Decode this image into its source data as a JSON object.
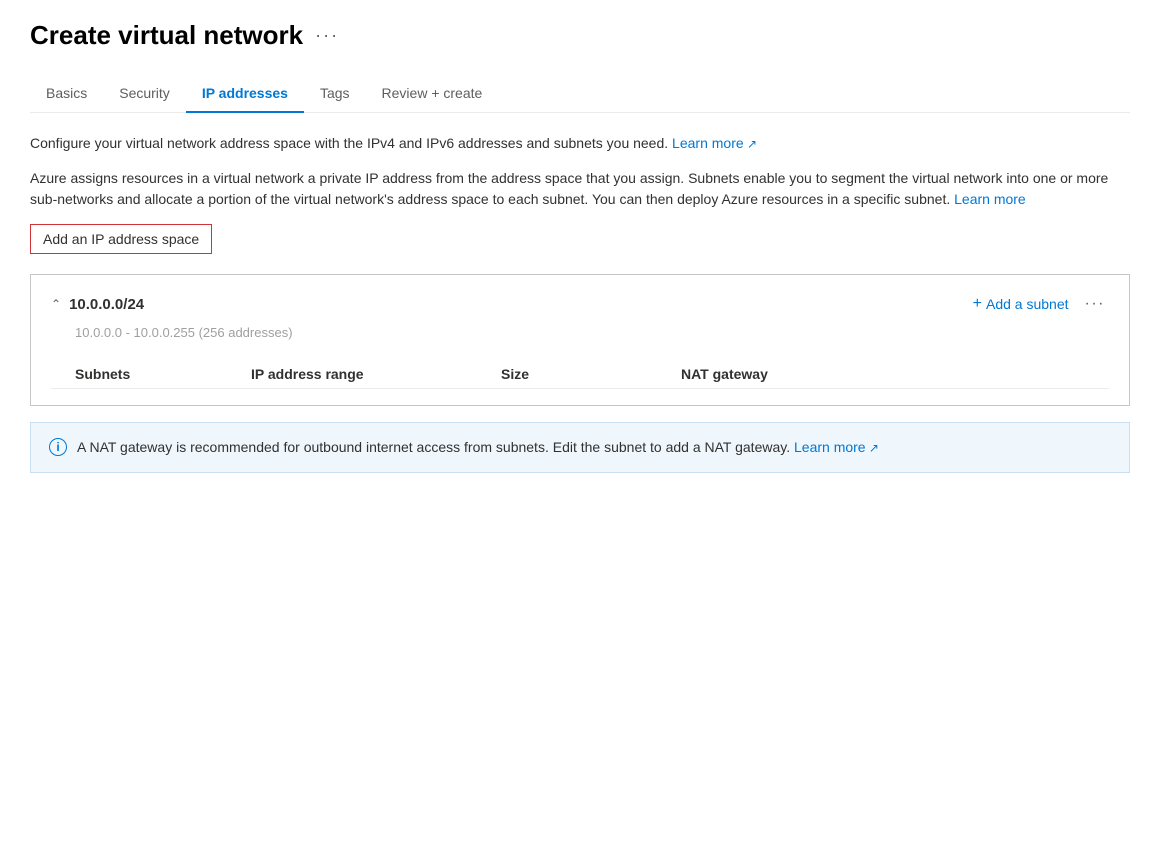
{
  "page": {
    "title": "Create virtual network",
    "more_icon": "···"
  },
  "tabs": [
    {
      "id": "basics",
      "label": "Basics",
      "active": false
    },
    {
      "id": "security",
      "label": "Security",
      "active": false
    },
    {
      "id": "ip-addresses",
      "label": "IP addresses",
      "active": true
    },
    {
      "id": "tags",
      "label": "Tags",
      "active": false
    },
    {
      "id": "review-create",
      "label": "Review + create",
      "active": false
    }
  ],
  "description1": "Configure your virtual network address space with the IPv4 and IPv6 addresses and subnets you need.",
  "description1_learn_more": "Learn more",
  "description2": "Azure assigns resources in a virtual network a private IP address from the address space that you assign. Subnets enable you to segment the virtual network into one or more sub-networks and allocate a portion of the virtual network's address space to each subnet. You can then deploy Azure resources in a specific subnet.",
  "description2_learn_more": "Learn more",
  "add_ip_button": "Add an IP address space",
  "address_space": {
    "cidr": "10.0.0.0/24",
    "range_text": "10.0.0.0 - 10.0.0.255 (256 addresses)",
    "add_subnet_label": "Add a subnet",
    "more_icon": "···",
    "columns": [
      {
        "label": "Subnets"
      },
      {
        "label": "IP address range"
      },
      {
        "label": "Size"
      },
      {
        "label": "NAT gateway"
      }
    ]
  },
  "nat_banner": {
    "text": "A NAT gateway is recommended for outbound internet access from subnets. Edit the subnet to add a NAT gateway.",
    "learn_more": "Learn more"
  }
}
